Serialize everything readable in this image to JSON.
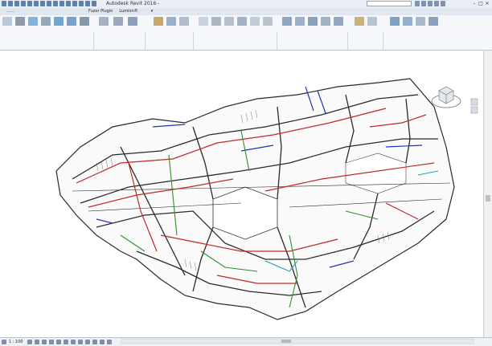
{
  "window": {
    "app_title": "Autodesk Revit 2016 - ",
    "search_placeholder": "",
    "login_label": "",
    "controls": [
      "–",
      "□",
      "×"
    ]
  },
  "tabs": [
    {
      "label": "",
      "active": false
    },
    {
      "label": "",
      "active": true
    },
    {
      "label": "",
      "active": false
    },
    {
      "label": "",
      "active": false
    },
    {
      "label": "",
      "active": false
    },
    {
      "label": "",
      "active": false
    },
    {
      "label": "",
      "active": false
    },
    {
      "label": "",
      "active": false
    },
    {
      "label": "",
      "active": false
    },
    {
      "label": "",
      "active": false
    },
    {
      "label": "",
      "active": false
    },
    {
      "label": "",
      "active": false
    },
    {
      "label": "",
      "active": false
    },
    {
      "label": "Fuzor Plugin",
      "active": false
    },
    {
      "label": "Lumion®",
      "active": false
    },
    {
      "label": "",
      "active": false
    }
  ],
  "ribbon": {
    "panels": [
      {
        "label": ""
      },
      {
        "label": ""
      },
      {
        "label": ""
      },
      {
        "label": ""
      },
      {
        "label": ""
      },
      {
        "label": ""
      },
      {
        "label": ""
      }
    ]
  },
  "view": {
    "cube_icon": "view-cube-icon",
    "corner_label": "",
    "scale": "1 : 100"
  },
  "colors": {
    "pipe_red": "#c0282c",
    "pipe_blue": "#1d33b8",
    "pipe_green": "#2f8f2f",
    "pipe_dark": "#2a2a2a",
    "pipe_cyan": "#1ba5b8",
    "ribbon_bg": "#f5f7fa",
    "tab_bg": "#dfe6f0",
    "context_tab": "#bfe0f7"
  }
}
